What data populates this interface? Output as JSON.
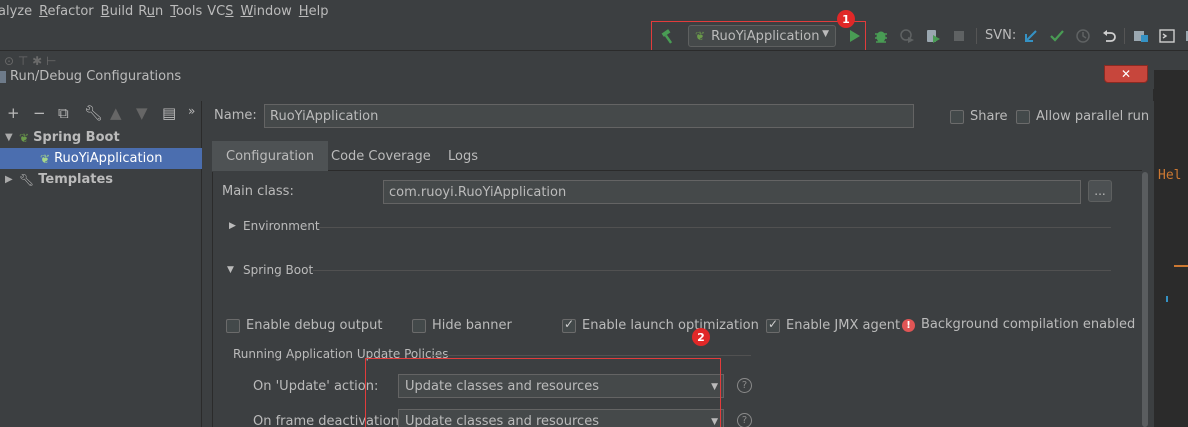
{
  "menu": {
    "items": [
      {
        "pre": "",
        "u": "",
        "post": "alyze"
      },
      {
        "pre": "",
        "u": "R",
        "post": "efactor"
      },
      {
        "pre": "",
        "u": "B",
        "post": "uild"
      },
      {
        "pre": "R",
        "u": "u",
        "post": "n"
      },
      {
        "pre": "",
        "u": "T",
        "post": "ools"
      },
      {
        "pre": "VC",
        "u": "S",
        "post": ""
      },
      {
        "pre": "",
        "u": "W",
        "post": "indow"
      },
      {
        "pre": "",
        "u": "H",
        "post": "elp"
      }
    ]
  },
  "toolbar": {
    "run_config": "RuoYiApplication",
    "svn_label": "SVN:",
    "icons": [
      "hammer-icon",
      "run-icon",
      "debug-icon",
      "coverage-icon",
      "profile-icon",
      "stop-icon",
      "svn-update-icon",
      "svn-commit-icon",
      "history-icon",
      "revert-icon",
      "project-structure-icon",
      "terminal-icon",
      "sdk-icon"
    ],
    "accent_green": "#499c54",
    "accent_blue": "#3592c4"
  },
  "annotations": {
    "badge_1": "1",
    "badge_2": "2",
    "color": "#e02828"
  },
  "editor": {
    "peek_text": "Hel"
  },
  "dialog": {
    "title": "Run/Debug Configurations",
    "close_symbol": "✕",
    "tree": {
      "group": "Spring Boot",
      "selected": "RuoYiApplication",
      "templates": "Templates"
    },
    "name_label": "Name:",
    "name_value": "RuoYiApplication",
    "share_label": "Share",
    "allow_parallel_label": "Allow parallel run",
    "tabs": [
      "Configuration",
      "Code Coverage",
      "Logs"
    ],
    "main_class_label": "Main class:",
    "main_class_value": "com.ruoyi.RuoYiApplication",
    "ellipsis": "...",
    "environment_label": "Environment",
    "spring_boot_label": "Spring Boot",
    "enable_debug_output": "Enable debug output",
    "hide_banner": "Hide banner",
    "enable_launch_optimization": "Enable launch optimization",
    "enable_jmx_agent": "Enable JMX agent",
    "background_compilation": "Background compilation enabled",
    "update_policies_label": "Running Application Update Policies",
    "on_update_label": "On 'Update' action:",
    "on_update_value": "Update classes and resources",
    "on_frame_label": "On frame deactivation:",
    "on_frame_value": "Update classes and resources",
    "help_symbol": "?"
  }
}
